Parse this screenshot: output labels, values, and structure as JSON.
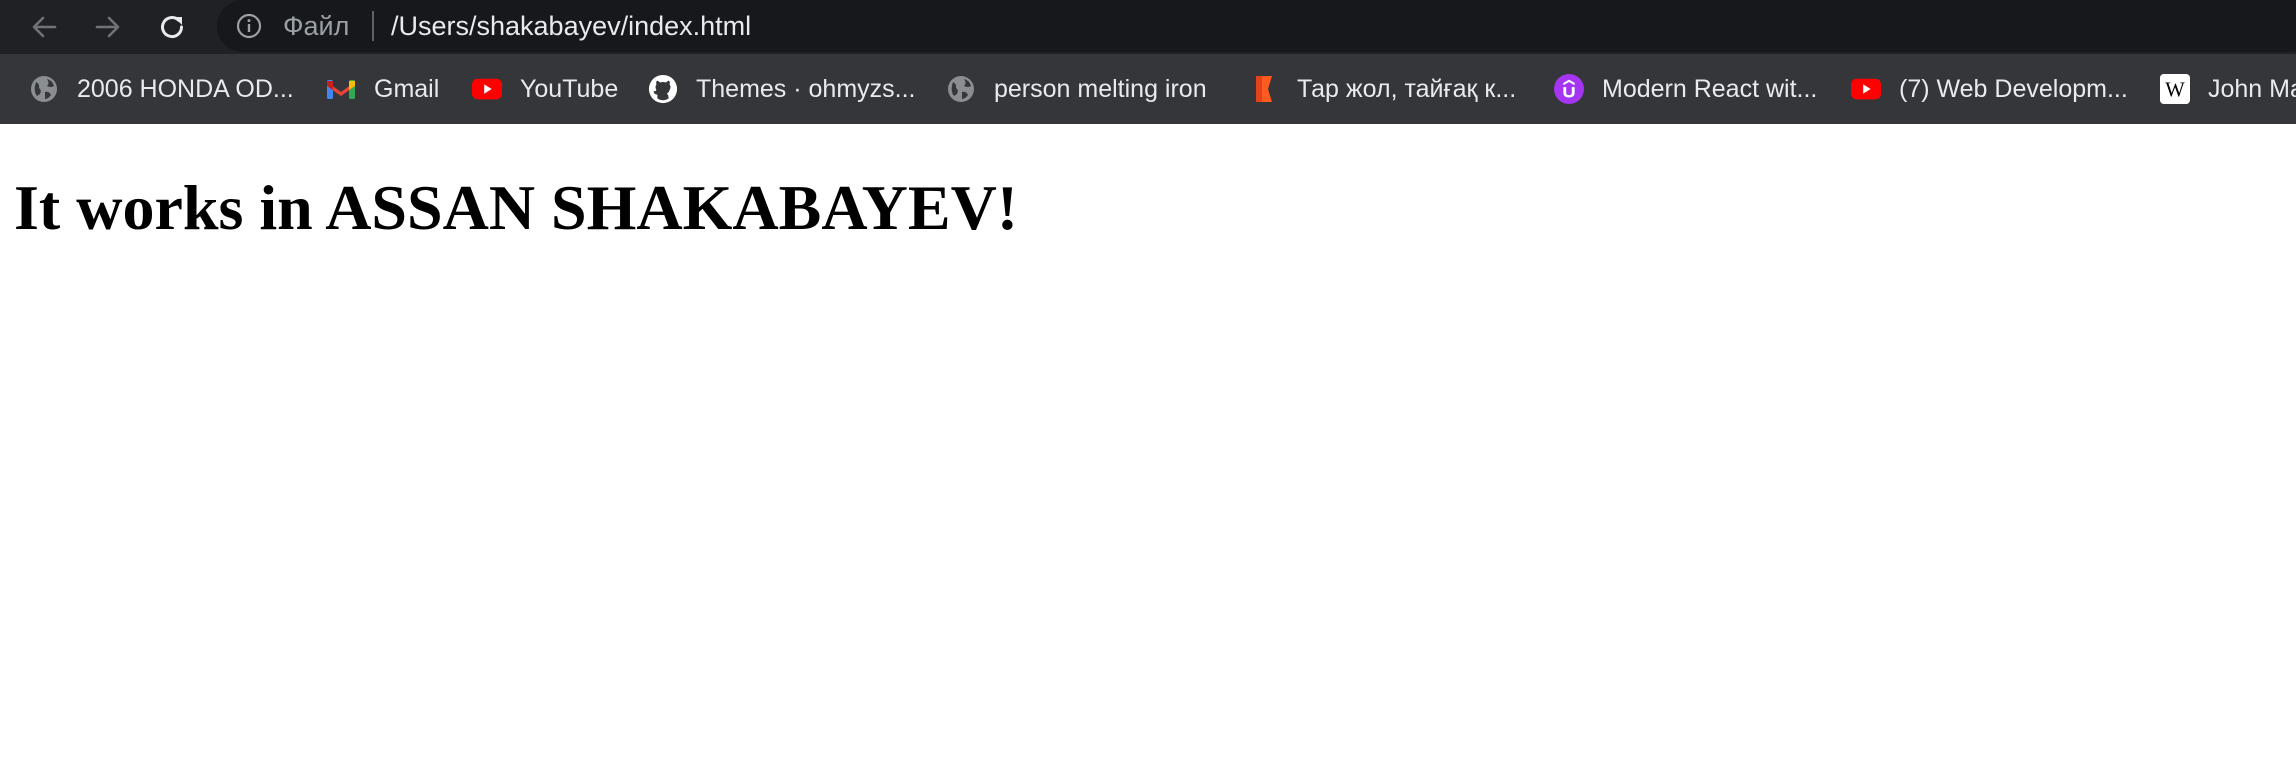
{
  "toolbar": {
    "back_icon": "arrow-left-icon",
    "forward_icon": "arrow-right-icon",
    "reload_icon": "reload-icon"
  },
  "omnibox": {
    "info_icon": "info-icon",
    "scheme_label": "Файл",
    "url": "/Users/shakabayev/index.html"
  },
  "bookmarks": [
    {
      "label": "2006 HONDA OD...",
      "icon": "globe-icon"
    },
    {
      "label": "Gmail",
      "icon": "gmail-icon"
    },
    {
      "label": "YouTube",
      "icon": "youtube-icon"
    },
    {
      "label": "Themes · ohmyzs...",
      "icon": "github-icon"
    },
    {
      "label": "person melting iron",
      "icon": "globe-icon"
    },
    {
      "label": "Тар жол, тайғақ к...",
      "icon": "bookmark-k-icon"
    },
    {
      "label": "Modern React wit...",
      "icon": "udemy-icon"
    },
    {
      "label": "(7) Web Developm...",
      "icon": "youtube-icon"
    },
    {
      "label": "John Ma",
      "icon": "wikipedia-icon"
    }
  ],
  "page": {
    "heading": "It works in ASSAN SHAKABAYEV!"
  },
  "colors": {
    "toolbar_bg": "#202124",
    "omnibox_bg": "#17181b",
    "bookmarks_bg": "#35363a",
    "youtube_red": "#ff0000",
    "udemy_purple": "#a435f0",
    "k_orange": "#ff5a1f"
  }
}
